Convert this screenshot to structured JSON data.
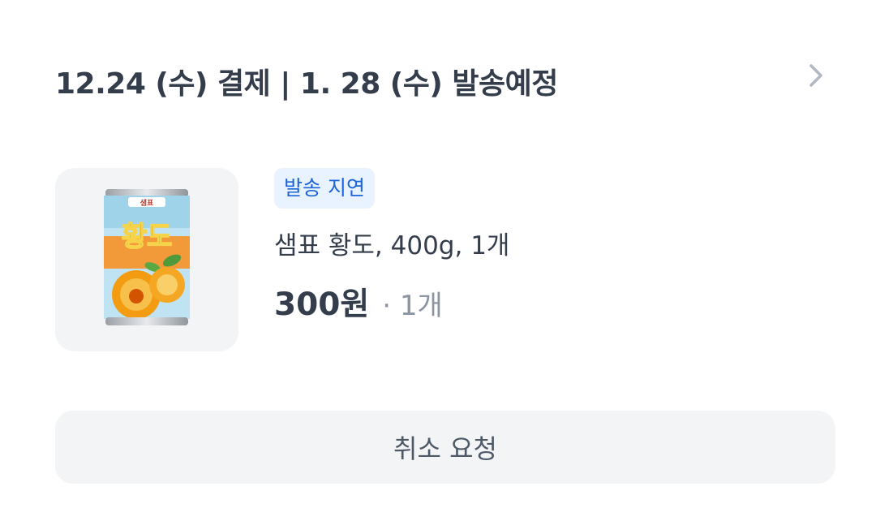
{
  "order": {
    "header_title": "12.24 (수) 결제 | 1. 28 (수) 발송예정",
    "status_badge": "발송 지연",
    "product": {
      "name": "샘표 황도, 400g, 1개",
      "image_label": "황도",
      "brand_label": "샘표",
      "price": "300원",
      "quantity": "· 1개"
    },
    "cancel_label": "취소 요청"
  },
  "colors": {
    "text_primary": "#333d4b",
    "text_secondary": "#8b95a1",
    "badge_bg": "#e8f3ff",
    "badge_text": "#1b64da",
    "button_bg": "#f2f4f6",
    "chevron": "#b0b8c1"
  },
  "icons": {
    "header_chevron": "chevron-right-icon"
  }
}
